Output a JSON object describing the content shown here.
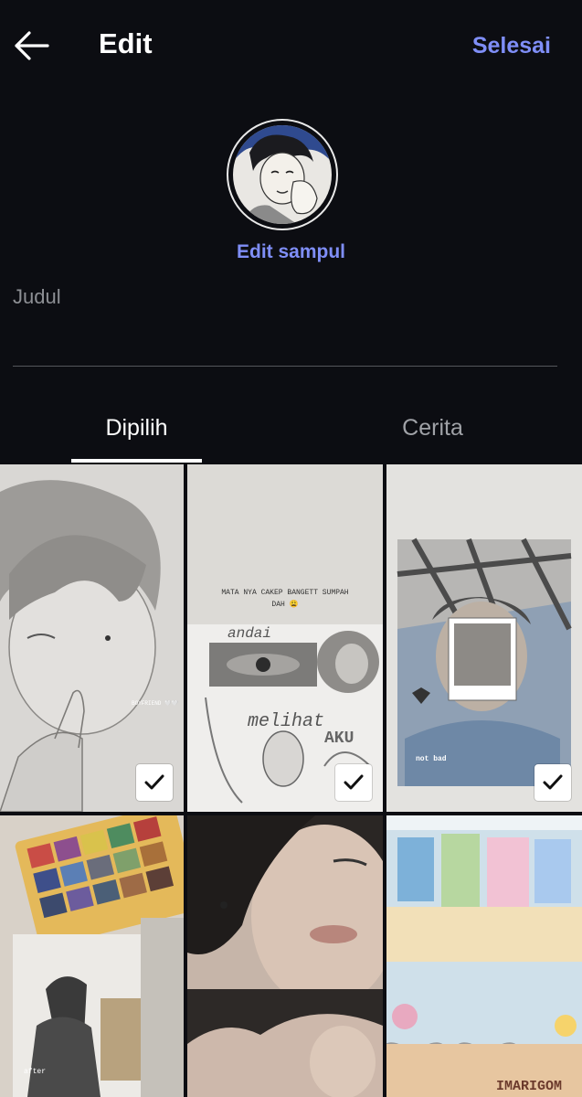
{
  "header": {
    "back_icon": "arrow-left-icon",
    "title": "Edit",
    "done_label": "Selesai"
  },
  "cover": {
    "edit_label": "Edit sampul"
  },
  "title_input": {
    "placeholder": "Judul",
    "value": ""
  },
  "tabs": [
    {
      "label": "Dipilih",
      "selected": true
    },
    {
      "label": "Cerita",
      "selected": false
    }
  ],
  "stories": [
    {
      "selected": true,
      "overlay": "BOYFRIEND 🤍🤍"
    },
    {
      "selected": true,
      "overlay": "MATA NYA CAKEP BANGETT SUMPAH DAH 😩",
      "overlay2": "andai",
      "overlay3": "melihat",
      "overlay4": "AKU"
    },
    {
      "selected": true,
      "overlay": "not bad"
    },
    {
      "selected": false,
      "overlay": "after"
    },
    {
      "selected": false,
      "overlay": ""
    },
    {
      "selected": false,
      "overlay": "IMARIGOM"
    }
  ],
  "colors": {
    "background": "#0c0d12",
    "accent": "#7f8ef7",
    "tab_inactive": "#a0a2a7"
  }
}
